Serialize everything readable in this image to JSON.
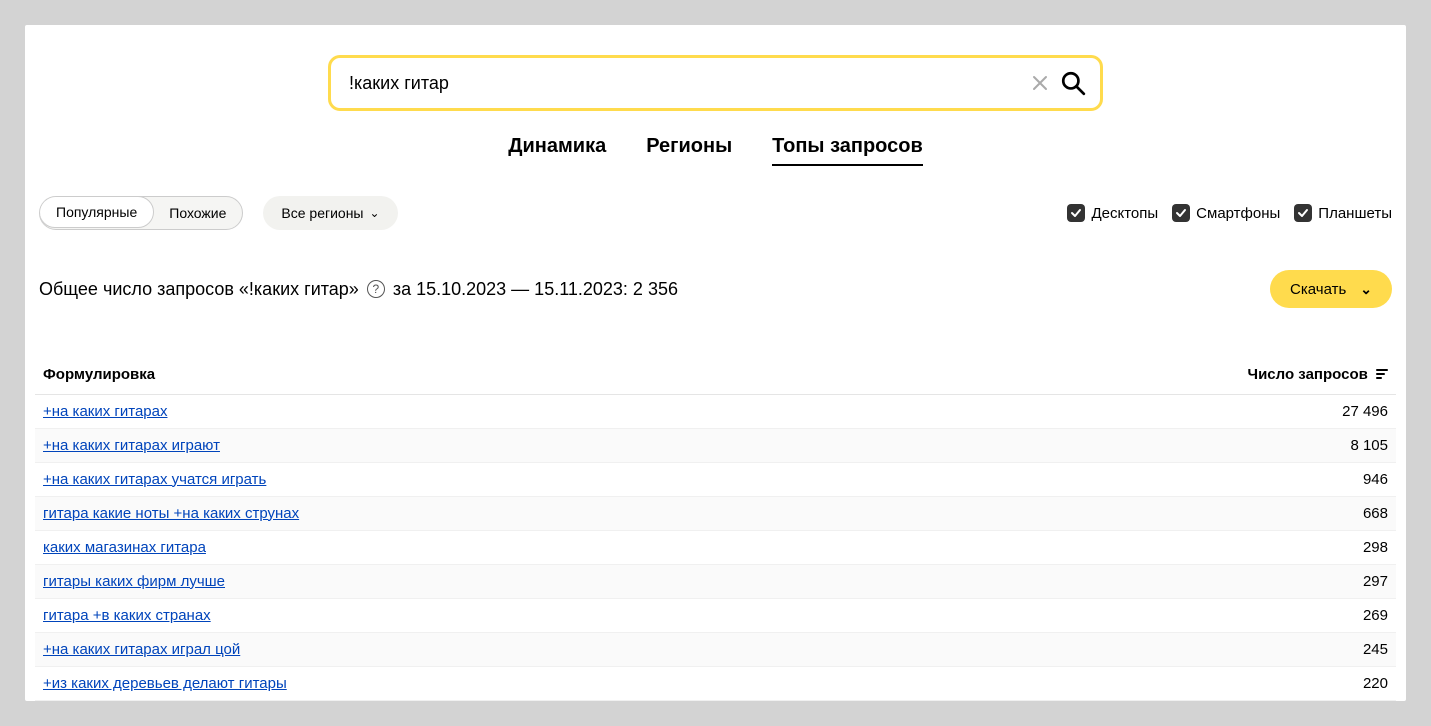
{
  "search": {
    "value": "!каких гитар"
  },
  "tabs": [
    {
      "label": "Динамика",
      "active": false
    },
    {
      "label": "Регионы",
      "active": false
    },
    {
      "label": "Топы запросов",
      "active": true
    }
  ],
  "filters": {
    "toggle": [
      {
        "label": "Популярные",
        "active": true
      },
      {
        "label": "Похожие",
        "active": false
      }
    ],
    "regions_label": "Все регионы",
    "devices": [
      {
        "label": "Десктопы"
      },
      {
        "label": "Смартфоны"
      },
      {
        "label": "Планшеты"
      }
    ]
  },
  "summary": {
    "prefix": "Общее число запросов «!каких гитар»",
    "suffix": "за 15.10.2023 — 15.11.2023: 2 356"
  },
  "download_label": "Скачать",
  "table": {
    "col_query": "Формулировка",
    "col_count": "Число запросов",
    "rows": [
      {
        "q": "+на каких гитарах",
        "c": "27 496"
      },
      {
        "q": "+на каких гитарах играют",
        "c": "8 105"
      },
      {
        "q": "+на каких гитарах учатся играть",
        "c": "946"
      },
      {
        "q": "гитара какие ноты +на каких струнах",
        "c": "668"
      },
      {
        "q": "каких магазинах гитара",
        "c": "298"
      },
      {
        "q": "гитары каких фирм лучше",
        "c": "297"
      },
      {
        "q": "гитара +в каких странах",
        "c": "269"
      },
      {
        "q": "+на каких гитарах играл цой",
        "c": "245"
      },
      {
        "q": "+из каких деревьев делают гитары",
        "c": "220"
      }
    ]
  }
}
